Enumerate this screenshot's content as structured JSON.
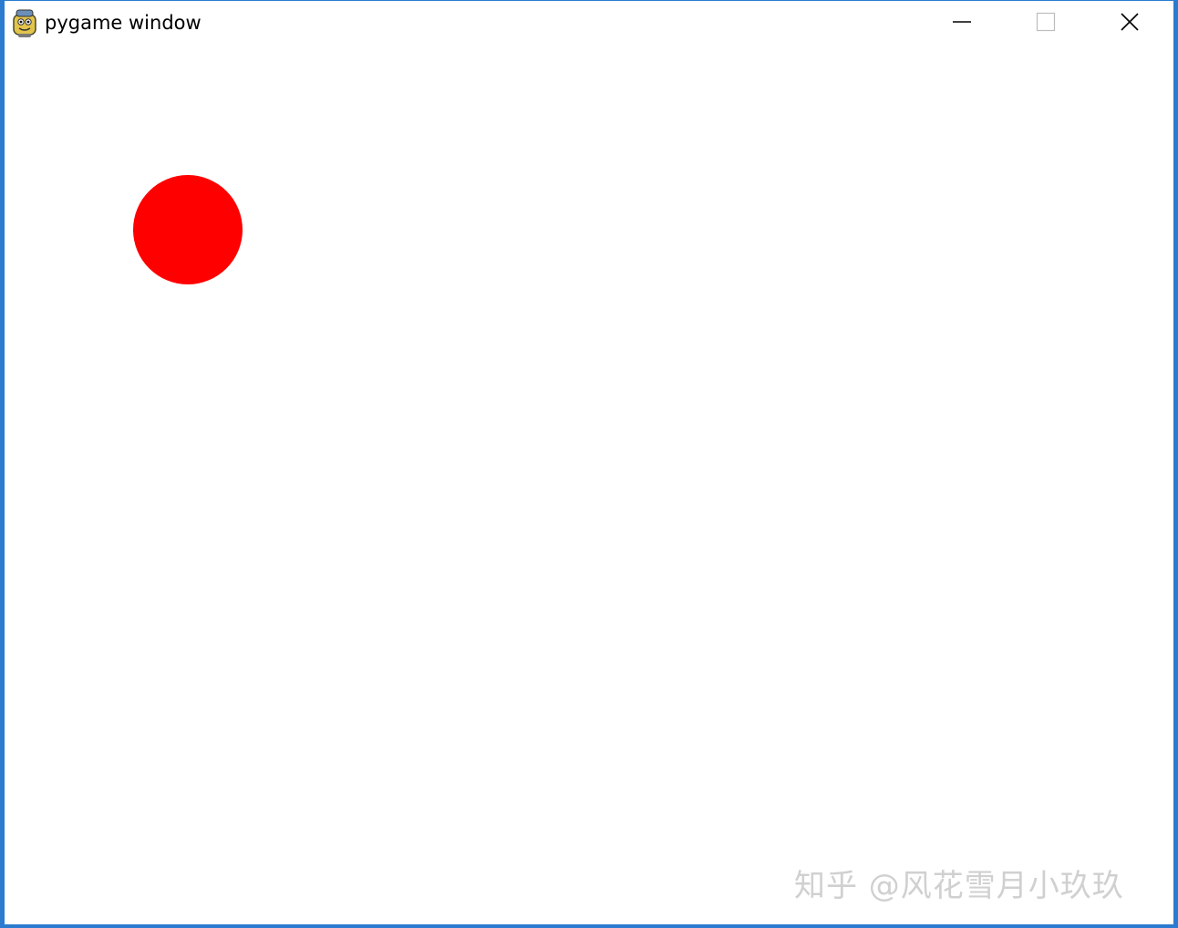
{
  "window": {
    "title": "pygame window",
    "app_icon": "pygame-snake-icon",
    "controls": {
      "minimize_icon": "minimize-icon",
      "maximize_icon": "maximize-icon",
      "close_icon": "close-icon"
    },
    "border_color": "#2b7bd0"
  },
  "canvas": {
    "background": "#ffffff",
    "ball": {
      "shape": "circle",
      "color": "#ff0000"
    }
  },
  "watermark": {
    "text": "知乎 @风花雪月小玖玖"
  }
}
